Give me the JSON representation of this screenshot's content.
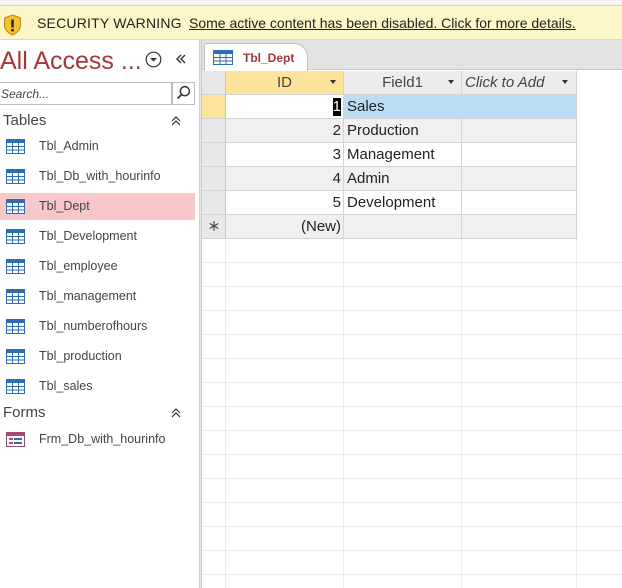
{
  "security_bar": {
    "title": "SECURITY WARNING",
    "message": "Some active content has been disabled. Click for more details."
  },
  "nav": {
    "title": "All Access ...",
    "search_placeholder": "Search...",
    "groups": [
      {
        "label": "Tables",
        "items": [
          {
            "label": "Tbl_Admin",
            "icon": "table-icon"
          },
          {
            "label": "Tbl_Db_with_hourinfo",
            "icon": "table-icon"
          },
          {
            "label": "Tbl_Dept",
            "icon": "table-icon",
            "selected": true
          },
          {
            "label": "Tbl_Development",
            "icon": "table-icon"
          },
          {
            "label": "Tbl_employee",
            "icon": "table-icon"
          },
          {
            "label": "Tbl_management",
            "icon": "table-icon"
          },
          {
            "label": "Tbl_numberofhours",
            "icon": "table-icon"
          },
          {
            "label": "Tbl_production",
            "icon": "table-icon"
          },
          {
            "label": "Tbl_sales",
            "icon": "table-icon"
          }
        ]
      },
      {
        "label": "Forms",
        "items": [
          {
            "label": "Frm_Db_with_hourinfo",
            "icon": "form-icon"
          }
        ]
      }
    ]
  },
  "document_tab": {
    "label": "Tbl_Dept",
    "icon": "table-icon"
  },
  "datasheet": {
    "columns": [
      "ID",
      "Field1",
      "Click to Add"
    ],
    "rows": [
      {
        "id": "1",
        "field1": "Sales"
      },
      {
        "id": "2",
        "field1": "Production"
      },
      {
        "id": "3",
        "field1": "Management"
      },
      {
        "id": "4",
        "field1": "Admin"
      },
      {
        "id": "5",
        "field1": "Development"
      }
    ],
    "new_row_label": "(New)"
  },
  "colors": {
    "accent": "#a4373a",
    "selected_nav": "#f7c7c9",
    "header_highlight": "#fde49a",
    "row_selection": "#bcdcf4",
    "warning_bar": "#fdf6c8"
  }
}
